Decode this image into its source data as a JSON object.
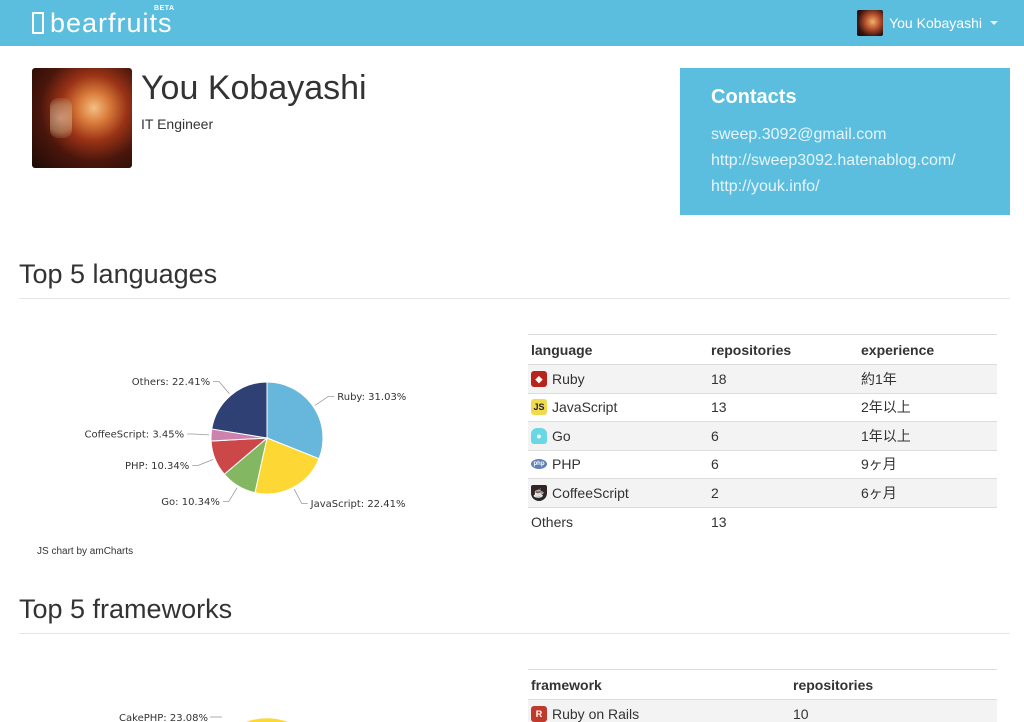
{
  "nav": {
    "brand_bear": "bear",
    "brand_fruits": "fruits",
    "beta": "BETA",
    "user_name": "You Kobayashi"
  },
  "profile": {
    "name": "You Kobayashi",
    "role": "IT Engineer"
  },
  "contacts": {
    "title": "Contacts",
    "links": [
      "sweep.3092@gmail.com",
      "http://sweep3092.hatenablog.com/",
      "http://youk.info/"
    ]
  },
  "languages_section": {
    "title": "Top 5 languages",
    "credit": "JS chart by amCharts",
    "table_headers": [
      "language",
      "repositories",
      "experience"
    ],
    "rows": [
      {
        "icon": "ruby-icon",
        "name": "Ruby",
        "repos": "18",
        "experience": "約1年"
      },
      {
        "icon": "javascript-icon",
        "name": "JavaScript",
        "repos": "13",
        "experience": "2年以上"
      },
      {
        "icon": "go-icon",
        "name": "Go",
        "repos": "6",
        "experience": "1年以上"
      },
      {
        "icon": "php-icon",
        "name": "PHP",
        "repos": "6",
        "experience": "9ヶ月"
      },
      {
        "icon": "coffeescript-icon",
        "name": "CoffeeScript",
        "repos": "2",
        "experience": "6ヶ月"
      },
      {
        "icon": "",
        "name": "Others",
        "repos": "13",
        "experience": ""
      }
    ]
  },
  "frameworks_section": {
    "title": "Top 5 frameworks",
    "table_headers": [
      "framework",
      "repositories"
    ],
    "rows": [
      {
        "icon": "rails-icon",
        "name": "Ruby on Rails",
        "repos": "10"
      }
    ],
    "chart_partial_label": "CakePHP: 23.08%"
  },
  "chart_data": {
    "type": "pie",
    "categories": [
      "Ruby",
      "JavaScript",
      "Go",
      "PHP",
      "CoffeeScript",
      "Others"
    ],
    "values": [
      31.03,
      22.41,
      10.34,
      10.34,
      3.45,
      22.41
    ],
    "labels": [
      "Ruby: 31.03%",
      "JavaScript: 22.41%",
      "Go: 10.34%",
      "PHP: 10.34%",
      "CoffeeScript: 3.45%",
      "Others: 22.41%"
    ],
    "colors": [
      "#67b7dc",
      "#fdd835",
      "#84b761",
      "#cc4748",
      "#cd82ad",
      "#2f4074"
    ],
    "title": "",
    "legend": "none"
  }
}
